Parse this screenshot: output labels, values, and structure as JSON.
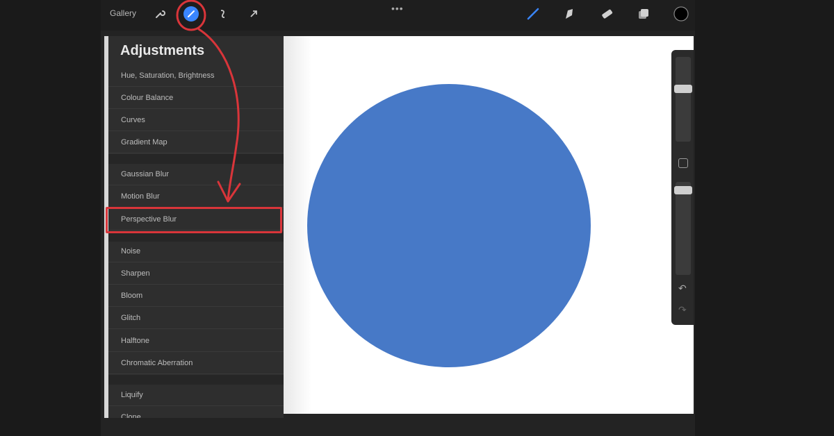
{
  "toolbar": {
    "gallery_label": "Gallery",
    "icons": [
      "wrench-icon",
      "magic-wand-icon",
      "selection-icon",
      "transform-arrow-icon",
      "brush-icon",
      "smudge-icon",
      "eraser-icon",
      "layers-icon",
      "color-swatch"
    ],
    "more_dots": "•••",
    "active_color": "#000000",
    "accent_color": "#3a86ff"
  },
  "panel": {
    "title": "Adjustments",
    "items": [
      "Hue, Saturation, Brightness",
      "Colour Balance",
      "Curves",
      "Gradient Map",
      "Gaussian Blur",
      "Motion Blur",
      "Perspective Blur",
      "Noise",
      "Sharpen",
      "Bloom",
      "Glitch",
      "Halftone",
      "Chromatic Aberration",
      "Liquify",
      "Clone"
    ],
    "highlighted_item": "Perspective Blur",
    "highlight_color": "#d9353a"
  },
  "canvas": {
    "shape": "circle",
    "fill_color": "#4779c7",
    "background": "#ffffff"
  },
  "sidebar": {
    "undo_symbol": "↶",
    "redo_symbol": "↷"
  }
}
